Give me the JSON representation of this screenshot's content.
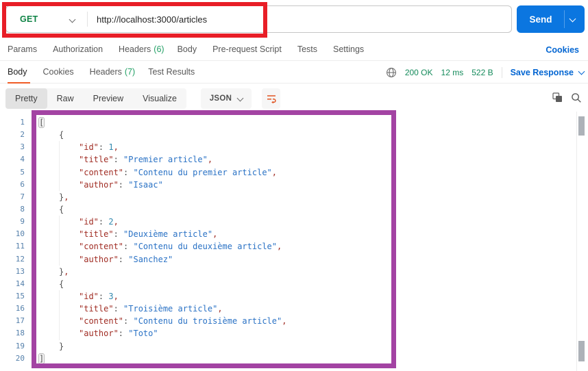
{
  "request": {
    "method": "GET",
    "url": "http://localhost:3000/articles",
    "send_label": "Send",
    "tabs": [
      {
        "label": "Params",
        "count": null
      },
      {
        "label": "Authorization",
        "count": null
      },
      {
        "label": "Headers",
        "count": "(6)"
      },
      {
        "label": "Body",
        "count": null
      },
      {
        "label": "Pre-request Script",
        "count": null
      },
      {
        "label": "Tests",
        "count": null
      },
      {
        "label": "Settings",
        "count": null
      }
    ],
    "cookies_link": "Cookies"
  },
  "response": {
    "tabs": [
      {
        "label": "Body",
        "count": null,
        "active": true
      },
      {
        "label": "Cookies",
        "count": null,
        "active": false
      },
      {
        "label": "Headers",
        "count": "(7)",
        "active": false
      },
      {
        "label": "Test Results",
        "count": null,
        "active": false
      }
    ],
    "status": "200 OK",
    "time": "12 ms",
    "size": "522 B",
    "save_label": "Save Response",
    "view_tabs": [
      "Pretty",
      "Raw",
      "Preview",
      "Visualize"
    ],
    "format_label": "JSON"
  },
  "icons": {
    "chevron": "chevron-down-icon",
    "globe": "globe-icon",
    "wrap": "text-wrap-icon",
    "copy": "copy-icon",
    "search": "search-icon"
  },
  "colors": {
    "method_green": "#0e8345",
    "status_green": "#138a5a",
    "count_green": "#23a066",
    "link_blue": "#0265d2",
    "send_blue": "#0b76e0",
    "accent_orange": "#ef5b25",
    "annotation_red": "#e81e27",
    "annotation_purple": "#a343a3",
    "key_color": "#a02c23",
    "string_color": "#2a72c5",
    "number_color": "#3188ae",
    "line_number_color": "#5580ab"
  },
  "editor": {
    "lines": [
      {
        "n": 1,
        "indent": 0,
        "tokens": [
          {
            "t": "[",
            "c": "p",
            "hl": true
          }
        ]
      },
      {
        "n": 2,
        "indent": 1,
        "tokens": [
          {
            "t": "{",
            "c": "p"
          }
        ]
      },
      {
        "n": 3,
        "indent": 2,
        "tokens": [
          {
            "t": "\"id\"",
            "c": "k"
          },
          {
            "t": ": ",
            "c": "p"
          },
          {
            "t": "1",
            "c": "n"
          },
          {
            "t": ",",
            "c": "c"
          }
        ]
      },
      {
        "n": 4,
        "indent": 2,
        "tokens": [
          {
            "t": "\"title\"",
            "c": "k"
          },
          {
            "t": ": ",
            "c": "p"
          },
          {
            "t": "\"Premier article\"",
            "c": "s"
          },
          {
            "t": ",",
            "c": "c"
          }
        ]
      },
      {
        "n": 5,
        "indent": 2,
        "tokens": [
          {
            "t": "\"content\"",
            "c": "k"
          },
          {
            "t": ": ",
            "c": "p"
          },
          {
            "t": "\"Contenu du premier article\"",
            "c": "s"
          },
          {
            "t": ",",
            "c": "c"
          }
        ]
      },
      {
        "n": 6,
        "indent": 2,
        "tokens": [
          {
            "t": "\"author\"",
            "c": "k"
          },
          {
            "t": ": ",
            "c": "p"
          },
          {
            "t": "\"Isaac\"",
            "c": "s"
          }
        ]
      },
      {
        "n": 7,
        "indent": 1,
        "tokens": [
          {
            "t": "}",
            "c": "p"
          },
          {
            "t": ",",
            "c": "c"
          }
        ]
      },
      {
        "n": 8,
        "indent": 1,
        "tokens": [
          {
            "t": "{",
            "c": "p"
          }
        ]
      },
      {
        "n": 9,
        "indent": 2,
        "tokens": [
          {
            "t": "\"id\"",
            "c": "k"
          },
          {
            "t": ": ",
            "c": "p"
          },
          {
            "t": "2",
            "c": "n"
          },
          {
            "t": ",",
            "c": "c"
          }
        ]
      },
      {
        "n": 10,
        "indent": 2,
        "tokens": [
          {
            "t": "\"title\"",
            "c": "k"
          },
          {
            "t": ": ",
            "c": "p"
          },
          {
            "t": "\"Deuxième article\"",
            "c": "s"
          },
          {
            "t": ",",
            "c": "c"
          }
        ]
      },
      {
        "n": 11,
        "indent": 2,
        "tokens": [
          {
            "t": "\"content\"",
            "c": "k"
          },
          {
            "t": ": ",
            "c": "p"
          },
          {
            "t": "\"Contenu du deuxième article\"",
            "c": "s"
          },
          {
            "t": ",",
            "c": "c"
          }
        ]
      },
      {
        "n": 12,
        "indent": 2,
        "tokens": [
          {
            "t": "\"author\"",
            "c": "k"
          },
          {
            "t": ": ",
            "c": "p"
          },
          {
            "t": "\"Sanchez\"",
            "c": "s"
          }
        ]
      },
      {
        "n": 13,
        "indent": 1,
        "tokens": [
          {
            "t": "}",
            "c": "p"
          },
          {
            "t": ",",
            "c": "c"
          }
        ]
      },
      {
        "n": 14,
        "indent": 1,
        "tokens": [
          {
            "t": "{",
            "c": "p"
          }
        ]
      },
      {
        "n": 15,
        "indent": 2,
        "tokens": [
          {
            "t": "\"id\"",
            "c": "k"
          },
          {
            "t": ": ",
            "c": "p"
          },
          {
            "t": "3",
            "c": "n"
          },
          {
            "t": ",",
            "c": "c"
          }
        ]
      },
      {
        "n": 16,
        "indent": 2,
        "tokens": [
          {
            "t": "\"title\"",
            "c": "k"
          },
          {
            "t": ": ",
            "c": "p"
          },
          {
            "t": "\"Troisième article\"",
            "c": "s"
          },
          {
            "t": ",",
            "c": "c"
          }
        ]
      },
      {
        "n": 17,
        "indent": 2,
        "tokens": [
          {
            "t": "\"content\"",
            "c": "k"
          },
          {
            "t": ": ",
            "c": "p"
          },
          {
            "t": "\"Contenu du troisième article\"",
            "c": "s"
          },
          {
            "t": ",",
            "c": "c"
          }
        ]
      },
      {
        "n": 18,
        "indent": 2,
        "tokens": [
          {
            "t": "\"author\"",
            "c": "k"
          },
          {
            "t": ": ",
            "c": "p"
          },
          {
            "t": "\"Toto\"",
            "c": "s"
          }
        ]
      },
      {
        "n": 19,
        "indent": 1,
        "tokens": [
          {
            "t": "}",
            "c": "p"
          }
        ]
      },
      {
        "n": 20,
        "indent": 0,
        "tokens": [
          {
            "t": "]",
            "c": "p",
            "hl": true
          }
        ]
      }
    ]
  }
}
